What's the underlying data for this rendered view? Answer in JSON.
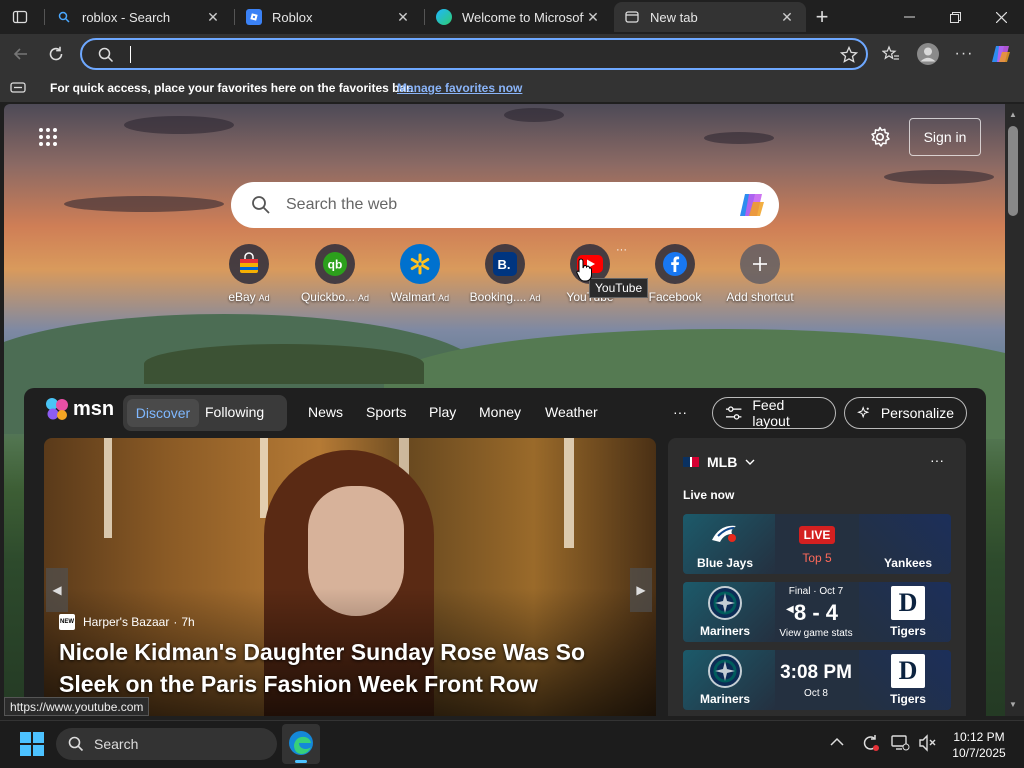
{
  "tabs": [
    {
      "title": "roblox - Search",
      "favicon": "search-icon"
    },
    {
      "title": "Roblox",
      "favicon": "roblox-icon"
    },
    {
      "title": "Welcome to Microsoft Edge",
      "favicon": "edge-icon"
    },
    {
      "title": "New tab",
      "favicon": "newtab-icon"
    }
  ],
  "address": {
    "value": ""
  },
  "favorites_bar": {
    "message": "For quick access, place your favorites here on the favorites bar.",
    "link": "Manage favorites now"
  },
  "newtab": {
    "sign_in": "Sign in",
    "search_placeholder": "Search the web",
    "tooltip": "YouTube",
    "shortcuts": [
      {
        "label": "eBay",
        "ad": "Ad"
      },
      {
        "label": "Quickbo...",
        "ad": "Ad"
      },
      {
        "label": "Walmart",
        "ad": "Ad"
      },
      {
        "label": "Booking....",
        "ad": "Ad"
      },
      {
        "label": "YouTube",
        "ad": ""
      },
      {
        "label": "Facebook",
        "ad": ""
      },
      {
        "label": "Add shortcut",
        "ad": ""
      }
    ]
  },
  "msn": {
    "brand": "msn",
    "tabs": [
      "Discover",
      "Following"
    ],
    "nav": [
      "News",
      "Sports",
      "Play",
      "Money",
      "Weather"
    ],
    "more": "···",
    "feed_layout": "Feed layout",
    "personalize": "Personalize"
  },
  "hero": {
    "source": "Harper's Bazaar",
    "age": "7h",
    "title": "Nicole Kidman's Daughter Sunday Rose Was So Sleek on the Paris Fashion Week Front Row"
  },
  "mlb": {
    "league": "MLB",
    "live_now": "Live now",
    "games": [
      {
        "away": "Blue Jays",
        "home": "Yankees",
        "status": "LIVE",
        "detail": "Top 5"
      },
      {
        "away": "Mariners",
        "home": "Tigers",
        "status": "Final · Oct 7",
        "score": "8 - 4",
        "detail": "View game stats"
      },
      {
        "away": "Mariners",
        "home": "Tigers",
        "time": "3:08 PM",
        "detail": "Oct 8"
      }
    ]
  },
  "status_url": "https://www.youtube.com",
  "taskbar": {
    "search_placeholder": "Search",
    "time": "10:12 PM",
    "date": "10/7/2025"
  }
}
